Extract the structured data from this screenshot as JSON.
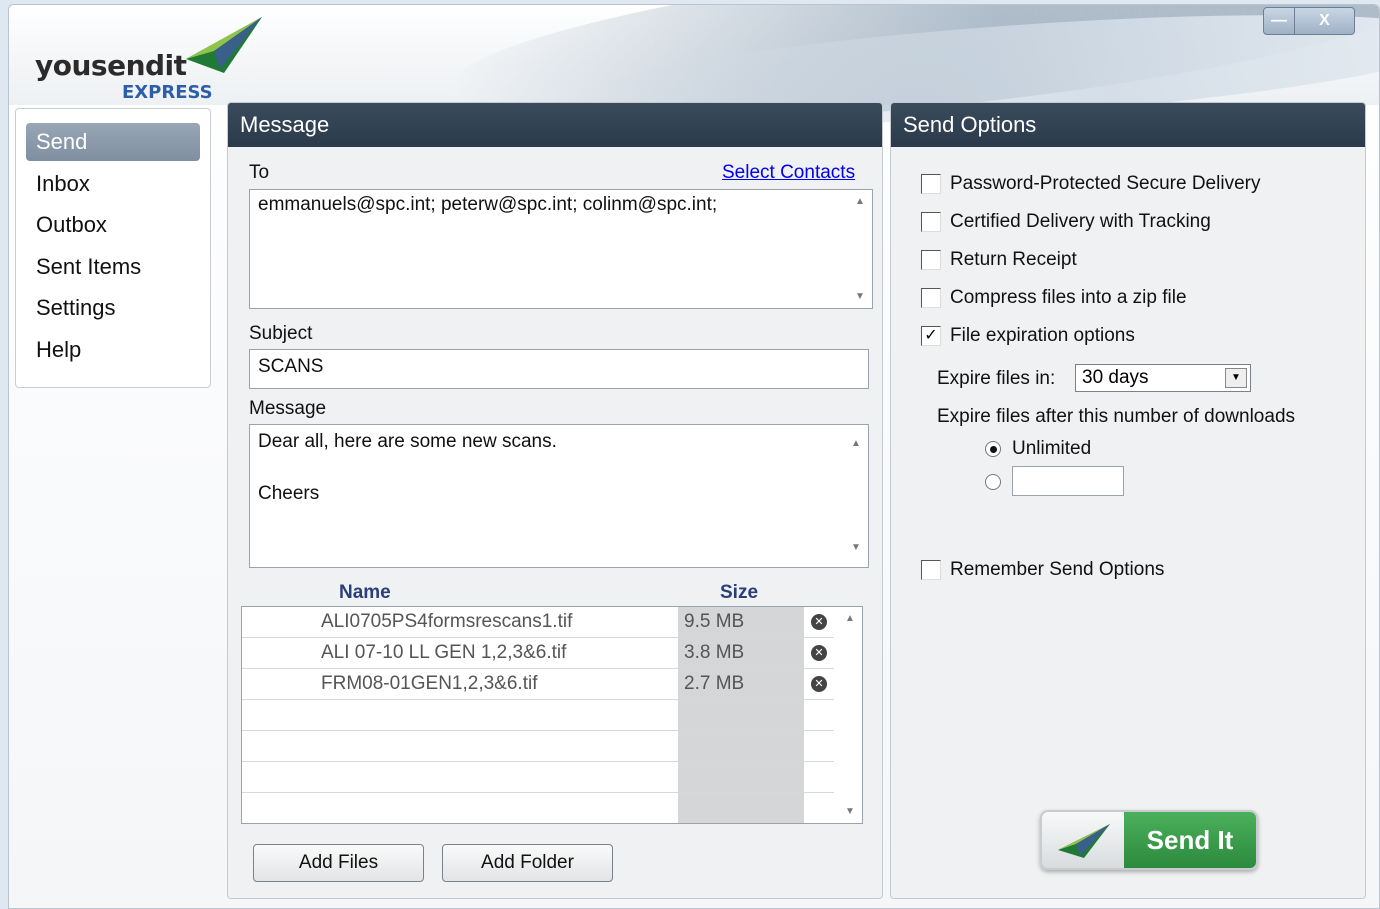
{
  "app": {
    "logo_text": "yousendit",
    "logo_sub": "EXPRESS"
  },
  "window_controls": {
    "minimize": "—",
    "close": "X"
  },
  "nav": {
    "items": [
      {
        "label": "Send",
        "active": true
      },
      {
        "label": "Inbox"
      },
      {
        "label": "Outbox"
      },
      {
        "label": "Sent Items"
      },
      {
        "label": "Settings"
      },
      {
        "label": "Help"
      }
    ]
  },
  "message": {
    "header": "Message",
    "to_label": "To",
    "select_contacts": "Select Contacts",
    "to_value": "emmanuels@spc.int; peterw@spc.int; colinm@spc.int;",
    "subject_label": "Subject",
    "subject_value": "SCANS",
    "message_label": "Message",
    "message_line1": "Dear all, here are some new scans.",
    "message_line2": "Cheers",
    "files_header_name": "Name",
    "files_header_size": "Size",
    "files": [
      {
        "name": "ALI0705PS4formsrescans1.tif",
        "size": "9.5 MB"
      },
      {
        "name": "ALI 07-10 LL GEN 1,2,3&6.tif",
        "size": "3.8 MB"
      },
      {
        "name": "FRM08-01GEN1,2,3&6.tif",
        "size": "2.7 MB"
      }
    ],
    "add_files": "Add Files",
    "add_folder": "Add Folder"
  },
  "options": {
    "header": "Send Options",
    "password_protected": "Password-Protected Secure Delivery",
    "certified_delivery": "Certified Delivery with Tracking",
    "return_receipt": "Return Receipt",
    "compress": "Compress files into a zip file",
    "expiration": "File expiration options",
    "expire_in_label": "Expire files in:",
    "expire_in_value": "30 days",
    "expire_downloads_label": "Expire files after this number of downloads",
    "unlimited": "Unlimited",
    "remember": "Remember Send Options",
    "send_it": "Send It"
  },
  "colors": {
    "accent_green": "#2c8a3d",
    "header_dark": "#2a3a4b",
    "link": "#0000ee"
  }
}
